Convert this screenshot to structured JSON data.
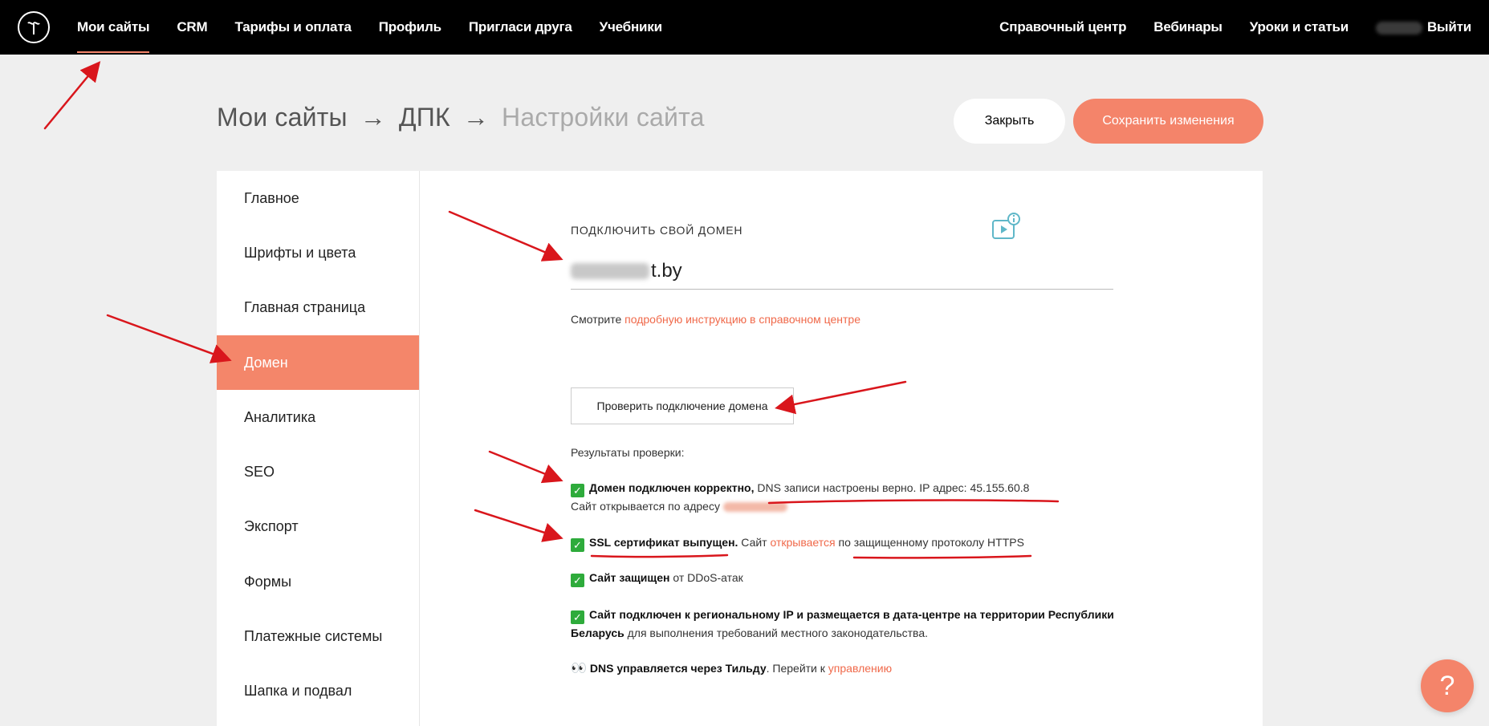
{
  "nav": {
    "left": [
      {
        "label": "Мои сайты",
        "active": true
      },
      {
        "label": "CRM"
      },
      {
        "label": "Тарифы и оплата"
      },
      {
        "label": "Профиль"
      },
      {
        "label": "Пригласи друга"
      },
      {
        "label": "Учебники"
      }
    ],
    "right": [
      {
        "label": "Справочный центр"
      },
      {
        "label": "Вебинары"
      },
      {
        "label": "Уроки и статьи"
      }
    ],
    "logout": "Выйти"
  },
  "breadcrumb": {
    "root": "Мои сайты",
    "arrow": "→",
    "project": "ДПК",
    "current": "Настройки сайта"
  },
  "actions": {
    "close": "Закрыть",
    "save": "Сохранить изменения"
  },
  "sidebar": {
    "items": [
      {
        "label": "Главное"
      },
      {
        "label": "Шрифты и цвета"
      },
      {
        "label": "Главная страница"
      },
      {
        "label": "Домен",
        "active": true
      },
      {
        "label": "Аналитика"
      },
      {
        "label": "SEO"
      },
      {
        "label": "Экспорт"
      },
      {
        "label": "Формы"
      },
      {
        "label": "Платежные системы"
      },
      {
        "label": "Шапка и подвал"
      }
    ]
  },
  "domain": {
    "label": "ПОДКЛЮЧИТЬ СВОЙ ДОМЕН",
    "value_visible": "t.by",
    "hint_prefix": "Смотрите ",
    "hint_link": "подробную инструкцию в справочном центре",
    "check_button": "Проверить подключение домена",
    "results_title": "Результаты проверки:"
  },
  "results": {
    "r1_bold": "Домен подключен корректно,",
    "r1_text": " DNS записи настроены верно. IP адрес: 45.155.60.8",
    "r1_line2": "Сайт открывается по адресу ",
    "r2_bold": "SSL сертификат выпущен.",
    "r2_text1": " Сайт ",
    "r2_link": "открывается",
    "r2_text2": " по защищенному протоколу HTTPS",
    "r3_bold": "Сайт защищен",
    "r3_text": " от DDoS-атак",
    "r4_bold": "Сайт подключен к региональному IP и размещается в дата-центре на территории Республики Беларусь",
    "r4_text": " для выполнения требований местного законодательства.",
    "r5_bold": "DNS управляется через Тильду",
    "r5_text": ". Перейти к ",
    "r5_link": "управлению"
  },
  "help": {
    "icon": "?"
  },
  "colors": {
    "accent": "#f4846a",
    "link": "#f0694a",
    "check": "#2eab3b",
    "annotation": "#d9161c"
  }
}
